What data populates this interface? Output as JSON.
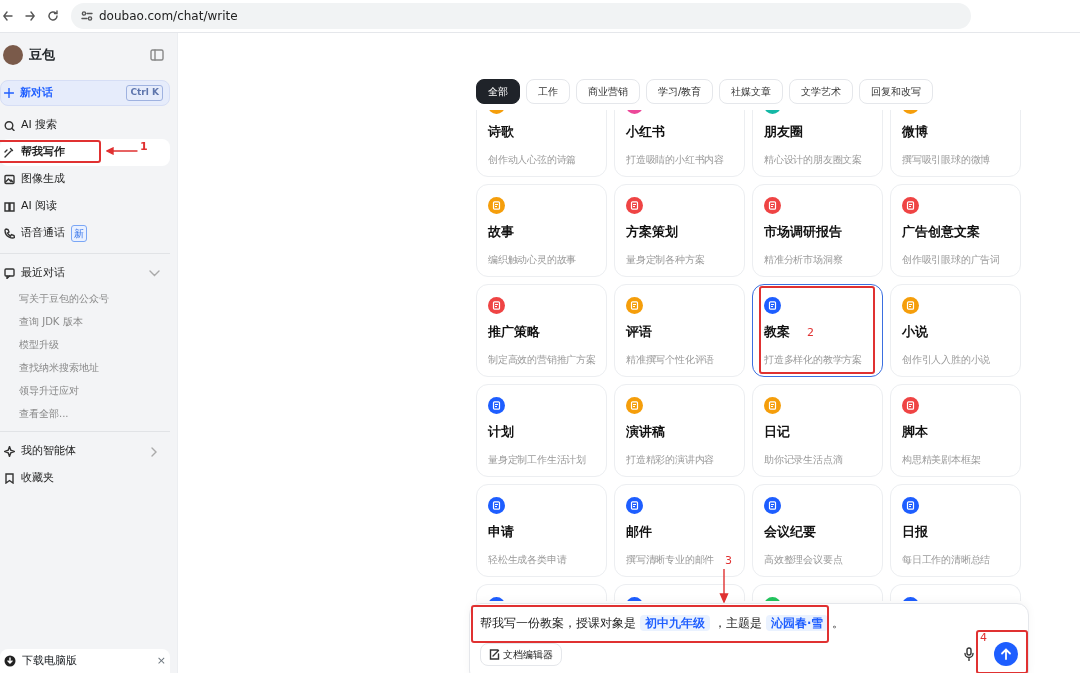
{
  "browser": {
    "url": "doubao.com/chat/write"
  },
  "sidebar": {
    "app_name": "豆包",
    "new_chat": {
      "label": "新对话",
      "shortcut": "Ctrl K"
    },
    "nav_items": [
      {
        "label": "AI 搜索",
        "selected": false
      },
      {
        "label": "帮我写作",
        "selected": true,
        "annotation": "1"
      },
      {
        "label": "图像生成",
        "selected": false
      },
      {
        "label": "AI 阅读",
        "selected": false
      },
      {
        "label": "语音通话",
        "selected": false,
        "badge": "新"
      }
    ],
    "recent": {
      "title": "最近对话",
      "expanded": true,
      "items": [
        "写关于豆包的公众号",
        "查询 JDK 版本",
        "模型升级",
        "查找纳米搜索地址",
        "领导升迁应对",
        "查看全部..."
      ]
    },
    "bottom_items": [
      {
        "label": "我的智能体"
      },
      {
        "label": "收藏夹"
      }
    ],
    "download": {
      "label": "下载电脑版",
      "close": "×"
    }
  },
  "tabs": [
    {
      "label": "全部",
      "selected": true
    },
    {
      "label": "工作",
      "selected": false
    },
    {
      "label": "商业营销",
      "selected": false
    },
    {
      "label": "学习/教育",
      "selected": false
    },
    {
      "label": "社媒文章",
      "selected": false
    },
    {
      "label": "文学艺术",
      "selected": false
    },
    {
      "label": "回复和改写",
      "selected": false
    }
  ],
  "cards": [
    {
      "title": "诗歌",
      "description": "创作动人心弦的诗篇",
      "color": "#f59e0b",
      "selected": false
    },
    {
      "title": "小红书",
      "description": "打造吸睛的小红书内容",
      "color": "#ec4899",
      "selected": false
    },
    {
      "title": "朋友圈",
      "description": "精心设计的朋友圈文案",
      "color": "#14b8a6",
      "selected": false
    },
    {
      "title": "微博",
      "description": "撰写吸引眼球的微博",
      "color": "#f59e0b",
      "selected": false
    },
    {
      "title": "故事",
      "description": "编织触动心灵的故事",
      "color": "#f59e0b",
      "selected": false
    },
    {
      "title": "方案策划",
      "description": "量身定制各种方案",
      "color": "#ef4444",
      "selected": false
    },
    {
      "title": "市场调研报告",
      "description": "精准分析市场洞察",
      "color": "#ef4444",
      "selected": false
    },
    {
      "title": "广告创意文案",
      "description": "创作吸引眼球的广告词",
      "color": "#ef4444",
      "selected": false
    },
    {
      "title": "推广策略",
      "description": "制定高效的营销推广方案",
      "color": "#ef4444",
      "selected": false
    },
    {
      "title": "评语",
      "description": "精准撰写个性化评语",
      "color": "#f59e0b",
      "selected": false
    },
    {
      "title": "教案",
      "description": "打造多样化的教学方案",
      "color": "#1e5eff",
      "selected": true,
      "annotation": "2"
    },
    {
      "title": "小说",
      "description": "创作引人入胜的小说",
      "color": "#f59e0b",
      "selected": false
    },
    {
      "title": "计划",
      "description": "量身定制工作生活计划",
      "color": "#1e5eff",
      "selected": false
    },
    {
      "title": "演讲稿",
      "description": "打造精彩的演讲内容",
      "color": "#f59e0b",
      "selected": false
    },
    {
      "title": "日记",
      "description": "助你记录生活点滴",
      "color": "#f59e0b",
      "selected": false
    },
    {
      "title": "脚本",
      "description": "构思精美剧本框架",
      "color": "#ef4444",
      "selected": false
    },
    {
      "title": "申请",
      "description": "轻松生成各类申请",
      "color": "#1e5eff",
      "selected": false
    },
    {
      "title": "邮件",
      "description": "撰写清晰专业的邮件",
      "color": "#1e5eff",
      "selected": false
    },
    {
      "title": "会议纪要",
      "description": "高效整理会议要点",
      "color": "#1e5eff",
      "selected": false
    },
    {
      "title": "日报",
      "description": "每日工作的清晰总结",
      "color": "#1e5eff",
      "selected": false
    },
    {
      "color": "#1e5eff",
      "selected": false
    },
    {
      "color": "#1e5eff",
      "selected": false
    },
    {
      "color": "#22c55e",
      "selected": false
    },
    {
      "color": "#1e5eff",
      "selected": false
    }
  ],
  "composer": {
    "annotation": "3",
    "segments": [
      {
        "kind": "plain",
        "text": "帮我写一份教案，授课对象是"
      },
      {
        "kind": "slot",
        "text": "初中九年级"
      },
      {
        "kind": "plain",
        "text": "，主题是"
      },
      {
        "kind": "slot",
        "text": "沁园春·雪"
      },
      {
        "kind": "plain",
        "text": "。"
      }
    ],
    "tool_button": "文档编辑器",
    "send_annotation": "4"
  }
}
